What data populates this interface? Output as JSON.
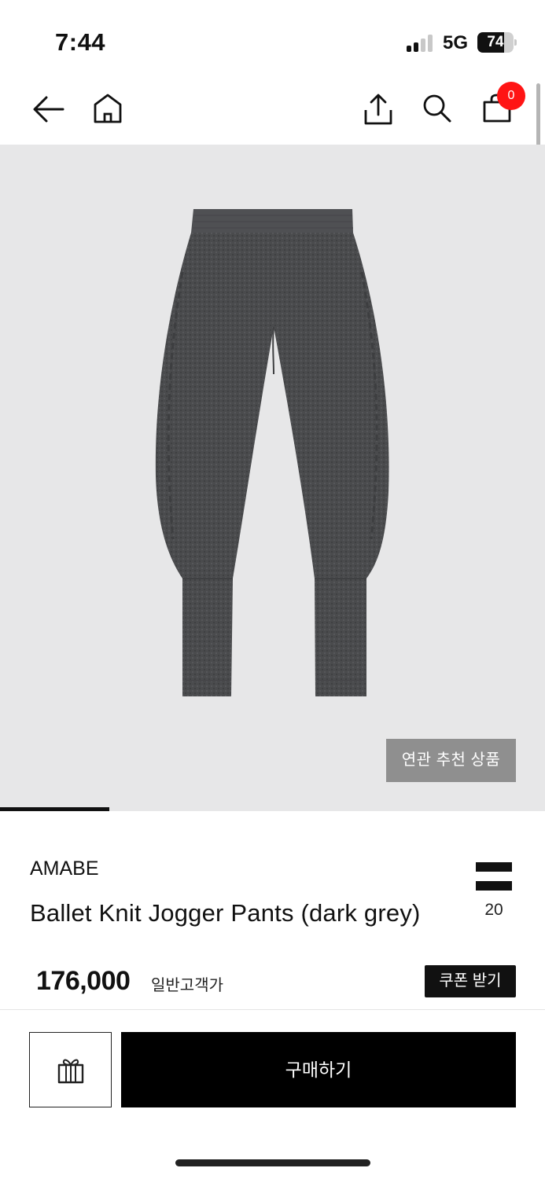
{
  "status_bar": {
    "time": "7:44",
    "network": "5G",
    "battery": "74",
    "battery_level": 0.74
  },
  "nav": {
    "cart_count": "0"
  },
  "hero": {
    "related_button": "연관 추천 상품",
    "gallery_progress": 0.2
  },
  "product": {
    "brand": "AMABE",
    "name": "Ballet Knit Jogger Pants (dark grey)",
    "menu_count": "20",
    "price": "176,000",
    "price_label": "일반고객가",
    "coupon_button": "쿠폰 받기"
  },
  "actions": {
    "buy_button": "구매하기"
  },
  "colors": {
    "accent_badge": "#ff1414",
    "primary": "#000000",
    "image_bg": "#e7e7e8",
    "garment": "#4a4b4d"
  }
}
